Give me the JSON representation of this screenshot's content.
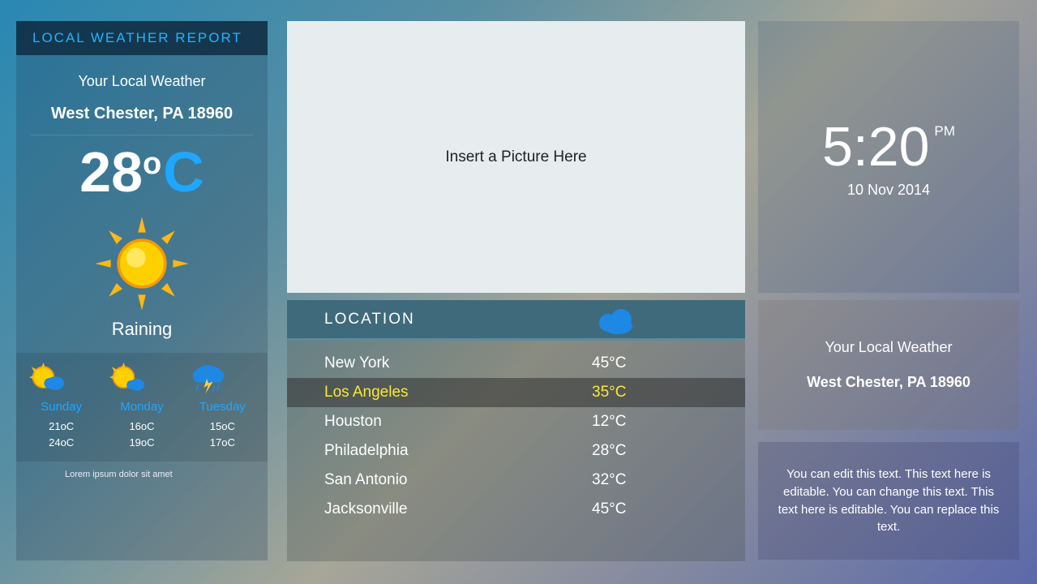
{
  "left": {
    "header": "LOCAL WEATHER  REPORT",
    "subheader": "Your Local Weather",
    "location": "West Chester, PA 18960",
    "temp_value": "28",
    "temp_degree": "o",
    "temp_unit": "C",
    "condition": "Raining",
    "forecast": [
      {
        "day": "Sunday",
        "hi": "21oC",
        "lo": "24oC"
      },
      {
        "day": "Monday",
        "hi": "16oC",
        "lo": "19oC"
      },
      {
        "day": "Tuesday",
        "hi": "15oC",
        "lo": "17oC"
      }
    ],
    "footnote": "Lorem ipsum dolor sit amet"
  },
  "center": {
    "placeholder": "Insert a Picture Here",
    "location_header": "LOCATION",
    "locations": [
      {
        "city": "New York",
        "temp": "45°C",
        "selected": false
      },
      {
        "city": "Los  Angeles",
        "temp": "35°C",
        "selected": true
      },
      {
        "city": "Houston",
        "temp": "12°C",
        "selected": false
      },
      {
        "city": "Philadelphia",
        "temp": "28°C",
        "selected": false
      },
      {
        "city": "San Antonio",
        "temp": "32°C",
        "selected": false
      },
      {
        "city": "Jacksonville",
        "temp": "45°C",
        "selected": false
      }
    ]
  },
  "right": {
    "time": "5:20",
    "ampm": "PM",
    "date": "10 Nov 2014",
    "mid_l1": "Your Local Weather",
    "mid_l2": "West Chester, PA 18960",
    "note": "You can edit this text. This text here is editable. You can change this text. This text here is editable. You can replace this text."
  }
}
